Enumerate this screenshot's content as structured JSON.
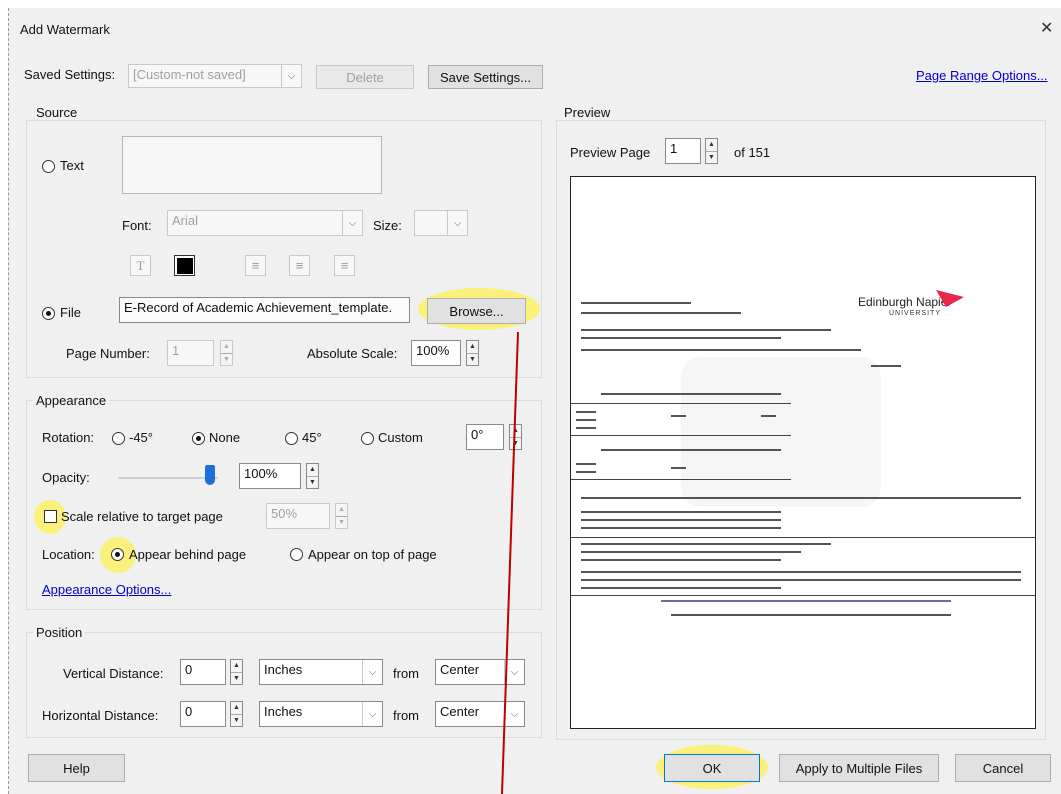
{
  "window": {
    "title": "Add Watermark",
    "close_icon": "close-icon"
  },
  "saved_settings": {
    "label": "Saved Settings:",
    "value": "[Custom-not saved]",
    "delete_label": "Delete",
    "save_label": "Save Settings..."
  },
  "page_range_link": "Page Range Options...",
  "source": {
    "title": "Source",
    "text_option": "Text",
    "text_selected": false,
    "font_label": "Font:",
    "font_value": "Arial",
    "size_label": "Size:",
    "file_option": "File",
    "file_selected": true,
    "file_value": "E-Record of Academic Achievement_template.",
    "browse_label": "Browse...",
    "page_number_label": "Page Number:",
    "page_number_value": "1",
    "absolute_scale_label": "Absolute Scale:",
    "absolute_scale_value": "100%"
  },
  "appearance": {
    "title": "Appearance",
    "rotation_label": "Rotation:",
    "rotation_options": [
      "-45°",
      "None",
      "45°",
      "Custom"
    ],
    "rotation_selected": "None",
    "custom_value": "0°",
    "opacity_label": "Opacity:",
    "opacity_value": "100%",
    "opacity_level": 1.0,
    "scale_label": "Scale relative to target page",
    "scale_checked": false,
    "scale_value": "50%",
    "location_label": "Location:",
    "location_behind": "Appear behind page",
    "location_on_top": "Appear on top of page",
    "location_selected": "behind",
    "options_link": "Appearance Options..."
  },
  "position": {
    "title": "Position",
    "vertical_label": "Vertical Distance:",
    "vertical_value": "0",
    "vertical_unit": "Inches",
    "vertical_from_label": "from",
    "vertical_from": "Center",
    "horizontal_label": "Horizontal Distance:",
    "horizontal_value": "0",
    "horizontal_unit": "Inches",
    "horizontal_from_label": "from",
    "horizontal_from": "Center"
  },
  "preview": {
    "title": "Preview",
    "page_label": "Preview Page",
    "page_value": "1",
    "of_label": "of 151",
    "brand_line1": "Edinburgh Napier",
    "brand_line2": "UNIVERSITY"
  },
  "buttons": {
    "help": "Help",
    "ok": "OK",
    "apply_multiple": "Apply to Multiple Files",
    "cancel": "Cancel"
  },
  "colors": {
    "highlight": "#fff03c",
    "annotation_line": "#c00000",
    "link": "#0000cc",
    "slider": "#1e6fd9",
    "brand_logo": "#e8274b"
  }
}
